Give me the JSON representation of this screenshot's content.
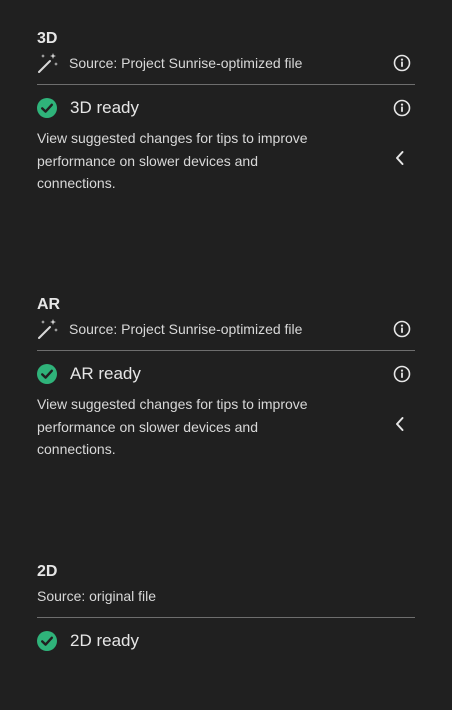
{
  "sections": [
    {
      "title": "3D",
      "source": "Source: Project Sunrise-optimized file",
      "status": "3D ready",
      "description": "View suggested changes for tips to improve performance on slower devices and connections."
    },
    {
      "title": "AR",
      "source": "Source: Project Sunrise-optimized file",
      "status": "AR ready",
      "description": "View suggested changes for tips to improve performance on slower devices and connections."
    },
    {
      "title": "2D",
      "source": "Source: original file",
      "status": "2D ready"
    }
  ],
  "colors": {
    "background": "#202020",
    "text": "#e6e6e6",
    "success": "#2fb37a",
    "divider": "#6e6e6e"
  },
  "icons": {
    "source": "magic-wand-icon",
    "info": "info-icon",
    "status": "check-circle-icon",
    "expand": "chevron-left-icon"
  }
}
